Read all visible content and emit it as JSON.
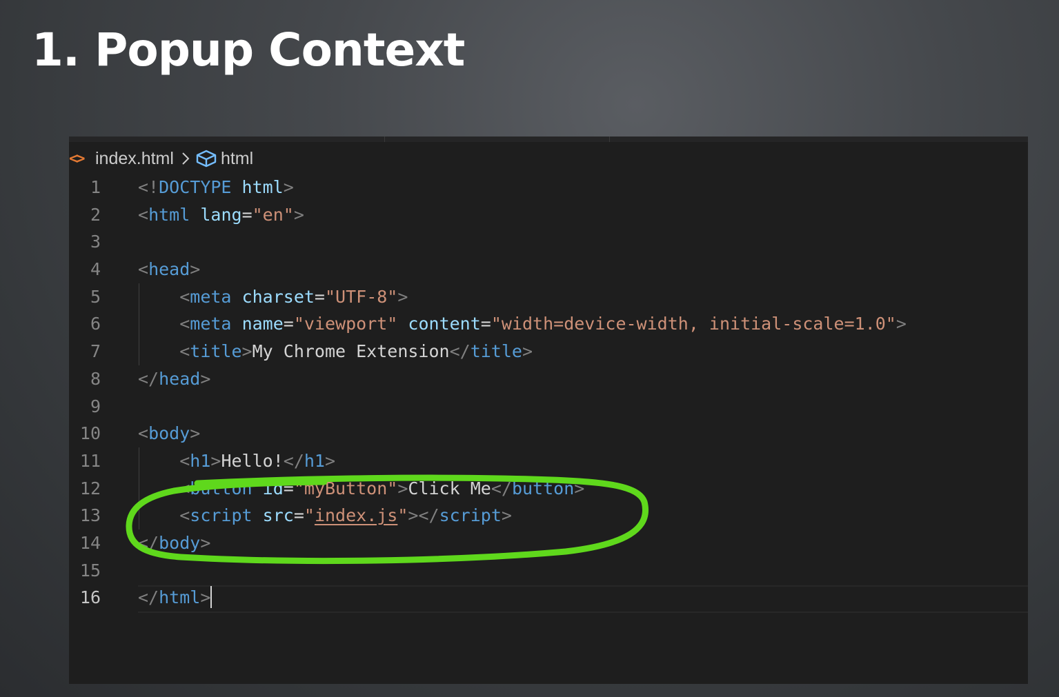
{
  "slide": {
    "title": "1. Popup Context"
  },
  "breadcrumb": {
    "file_name": "index.html",
    "element_name": "html",
    "file_icon_glyph": "<>",
    "file_icon": "html-file-icon",
    "element_icon": "symbol-element-icon"
  },
  "editor": {
    "active_line": 16,
    "lines": [
      {
        "number": "1",
        "tokens": [
          {
            "t": "<!",
            "c": "punc"
          },
          {
            "t": "DOCTYPE",
            "c": "tag"
          },
          {
            "t": " ",
            "c": "text"
          },
          {
            "t": "html",
            "c": "attr"
          },
          {
            "t": ">",
            "c": "punc"
          }
        ]
      },
      {
        "number": "2",
        "tokens": [
          {
            "t": "<",
            "c": "punc"
          },
          {
            "t": "html",
            "c": "tag"
          },
          {
            "t": " ",
            "c": "text"
          },
          {
            "t": "lang",
            "c": "attr"
          },
          {
            "t": "=",
            "c": "text"
          },
          {
            "t": "\"en\"",
            "c": "str"
          },
          {
            "t": ">",
            "c": "punc"
          }
        ]
      },
      {
        "number": "3",
        "tokens": []
      },
      {
        "number": "4",
        "tokens": [
          {
            "t": "<",
            "c": "punc"
          },
          {
            "t": "head",
            "c": "tag"
          },
          {
            "t": ">",
            "c": "punc"
          }
        ]
      },
      {
        "number": "5",
        "tokens": [
          {
            "t": "    ",
            "c": "text"
          },
          {
            "t": "<",
            "c": "punc"
          },
          {
            "t": "meta",
            "c": "tag"
          },
          {
            "t": " ",
            "c": "text"
          },
          {
            "t": "charset",
            "c": "attr"
          },
          {
            "t": "=",
            "c": "text"
          },
          {
            "t": "\"UTF-8\"",
            "c": "str"
          },
          {
            "t": ">",
            "c": "punc"
          }
        ]
      },
      {
        "number": "6",
        "tokens": [
          {
            "t": "    ",
            "c": "text"
          },
          {
            "t": "<",
            "c": "punc"
          },
          {
            "t": "meta",
            "c": "tag"
          },
          {
            "t": " ",
            "c": "text"
          },
          {
            "t": "name",
            "c": "attr"
          },
          {
            "t": "=",
            "c": "text"
          },
          {
            "t": "\"viewport\"",
            "c": "str"
          },
          {
            "t": " ",
            "c": "text"
          },
          {
            "t": "content",
            "c": "attr"
          },
          {
            "t": "=",
            "c": "text"
          },
          {
            "t": "\"width=device-width, initial-scale=1.0\"",
            "c": "str"
          },
          {
            "t": ">",
            "c": "punc"
          }
        ]
      },
      {
        "number": "7",
        "tokens": [
          {
            "t": "    ",
            "c": "text"
          },
          {
            "t": "<",
            "c": "punc"
          },
          {
            "t": "title",
            "c": "tag"
          },
          {
            "t": ">",
            "c": "punc"
          },
          {
            "t": "My Chrome Extension",
            "c": "text"
          },
          {
            "t": "</",
            "c": "punc"
          },
          {
            "t": "title",
            "c": "tag"
          },
          {
            "t": ">",
            "c": "punc"
          }
        ]
      },
      {
        "number": "8",
        "tokens": [
          {
            "t": "</",
            "c": "punc"
          },
          {
            "t": "head",
            "c": "tag"
          },
          {
            "t": ">",
            "c": "punc"
          }
        ]
      },
      {
        "number": "9",
        "tokens": []
      },
      {
        "number": "10",
        "tokens": [
          {
            "t": "<",
            "c": "punc"
          },
          {
            "t": "body",
            "c": "tag"
          },
          {
            "t": ">",
            "c": "punc"
          }
        ]
      },
      {
        "number": "11",
        "tokens": [
          {
            "t": "    ",
            "c": "text"
          },
          {
            "t": "<",
            "c": "punc"
          },
          {
            "t": "h1",
            "c": "tag"
          },
          {
            "t": ">",
            "c": "punc"
          },
          {
            "t": "Hello!",
            "c": "text"
          },
          {
            "t": "</",
            "c": "punc"
          },
          {
            "t": "h1",
            "c": "tag"
          },
          {
            "t": ">",
            "c": "punc"
          }
        ]
      },
      {
        "number": "12",
        "tokens": [
          {
            "t": "    ",
            "c": "text"
          },
          {
            "t": "<",
            "c": "punc"
          },
          {
            "t": "button",
            "c": "tag"
          },
          {
            "t": " ",
            "c": "text"
          },
          {
            "t": "id",
            "c": "attr"
          },
          {
            "t": "=",
            "c": "text"
          },
          {
            "t": "\"myButton\"",
            "c": "str"
          },
          {
            "t": ">",
            "c": "punc"
          },
          {
            "t": "Click Me",
            "c": "text"
          },
          {
            "t": "</",
            "c": "punc"
          },
          {
            "t": "button",
            "c": "tag"
          },
          {
            "t": ">",
            "c": "punc"
          }
        ]
      },
      {
        "number": "13",
        "tokens": [
          {
            "t": "    ",
            "c": "text"
          },
          {
            "t": "<",
            "c": "punc"
          },
          {
            "t": "script",
            "c": "tag"
          },
          {
            "t": " ",
            "c": "text"
          },
          {
            "t": "src",
            "c": "attr"
          },
          {
            "t": "=",
            "c": "text"
          },
          {
            "t": "\"",
            "c": "str"
          },
          {
            "t": "index.js",
            "c": "str-link"
          },
          {
            "t": "\"",
            "c": "str"
          },
          {
            "t": "></",
            "c": "punc"
          },
          {
            "t": "script",
            "c": "tag"
          },
          {
            "t": ">",
            "c": "punc"
          }
        ]
      },
      {
        "number": "14",
        "tokens": [
          {
            "t": "</",
            "c": "punc"
          },
          {
            "t": "body",
            "c": "tag"
          },
          {
            "t": ">",
            "c": "punc"
          }
        ]
      },
      {
        "number": "15",
        "tokens": []
      },
      {
        "number": "16",
        "tokens": [
          {
            "t": "</",
            "c": "punc"
          },
          {
            "t": "html",
            "c": "tag"
          },
          {
            "t": ">",
            "c": "punc"
          }
        ]
      }
    ]
  },
  "colors": {
    "highlight_stroke": "#5fd81c"
  }
}
